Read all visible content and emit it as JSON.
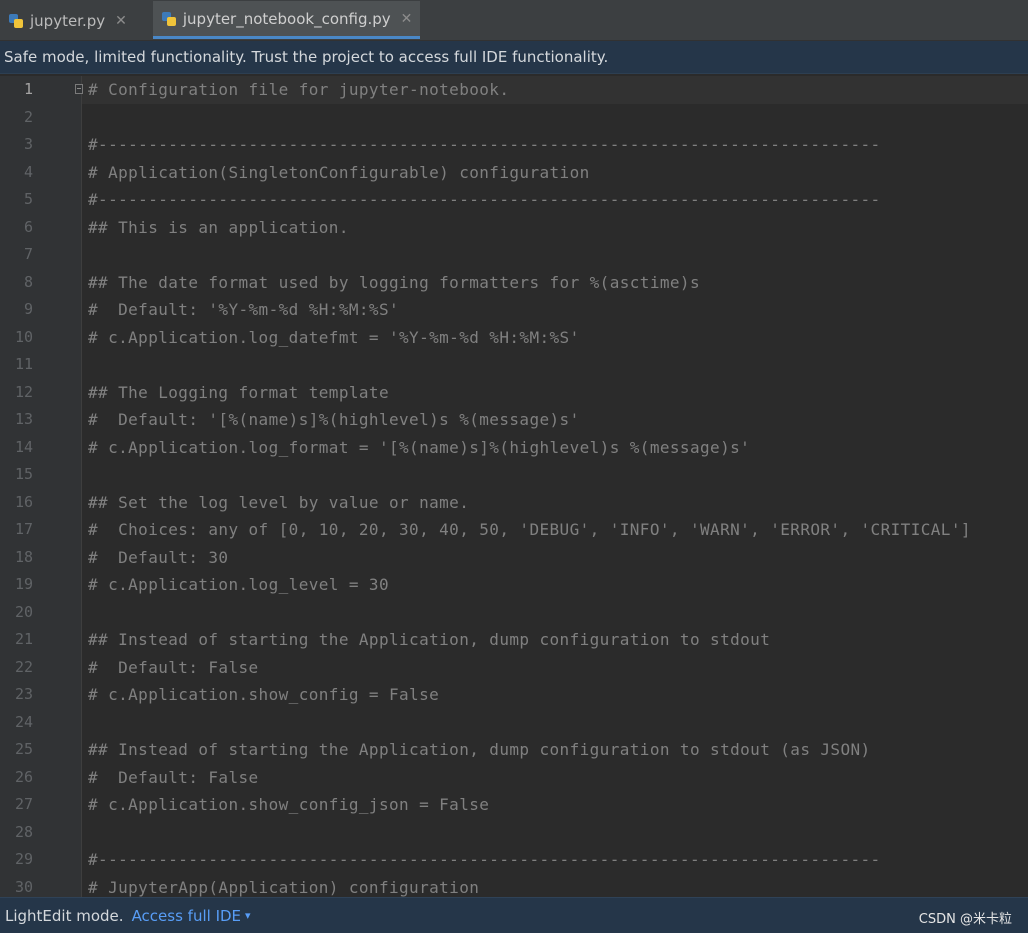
{
  "tabs": [
    {
      "label": "jupyter.py",
      "active": false
    },
    {
      "label": "jupyter_notebook_config.py",
      "active": true
    }
  ],
  "banner": {
    "text": "Safe mode, limited functionality. Trust the project to access full IDE functionality."
  },
  "editor": {
    "current_line": 1,
    "lines": [
      {
        "n": "1",
        "text": "# Configuration file for jupyter-notebook."
      },
      {
        "n": "2",
        "text": ""
      },
      {
        "n": "3",
        "text": "#------------------------------------------------------------------------------"
      },
      {
        "n": "4",
        "text": "# Application(SingletonConfigurable) configuration"
      },
      {
        "n": "5",
        "text": "#------------------------------------------------------------------------------"
      },
      {
        "n": "6",
        "text": "## This is an application."
      },
      {
        "n": "7",
        "text": ""
      },
      {
        "n": "8",
        "text": "## The date format used by logging formatters for %(asctime)s"
      },
      {
        "n": "9",
        "text": "#  Default: '%Y-%m-%d %H:%M:%S'"
      },
      {
        "n": "10",
        "text": "# c.Application.log_datefmt = '%Y-%m-%d %H:%M:%S'"
      },
      {
        "n": "11",
        "text": ""
      },
      {
        "n": "12",
        "text": "## The Logging format template"
      },
      {
        "n": "13",
        "text": "#  Default: '[%(name)s]%(highlevel)s %(message)s'"
      },
      {
        "n": "14",
        "text": "# c.Application.log_format = '[%(name)s]%(highlevel)s %(message)s'"
      },
      {
        "n": "15",
        "text": ""
      },
      {
        "n": "16",
        "text": "## Set the log level by value or name."
      },
      {
        "n": "17",
        "text": "#  Choices: any of [0, 10, 20, 30, 40, 50, 'DEBUG', 'INFO', 'WARN', 'ERROR', 'CRITICAL']"
      },
      {
        "n": "18",
        "text": "#  Default: 30"
      },
      {
        "n": "19",
        "text": "# c.Application.log_level = 30"
      },
      {
        "n": "20",
        "text": ""
      },
      {
        "n": "21",
        "text": "## Instead of starting the Application, dump configuration to stdout"
      },
      {
        "n": "22",
        "text": "#  Default: False"
      },
      {
        "n": "23",
        "text": "# c.Application.show_config = False"
      },
      {
        "n": "24",
        "text": ""
      },
      {
        "n": "25",
        "text": "## Instead of starting the Application, dump configuration to stdout (as JSON)"
      },
      {
        "n": "26",
        "text": "#  Default: False"
      },
      {
        "n": "27",
        "text": "# c.Application.show_config_json = False"
      },
      {
        "n": "28",
        "text": ""
      },
      {
        "n": "29",
        "text": "#------------------------------------------------------------------------------"
      },
      {
        "n": "30",
        "text": "# JupyterApp(Application) configuration"
      }
    ]
  },
  "statusbar": {
    "mode": "LightEdit mode.",
    "link": "Access full IDE",
    "watermark": "CSDN @米卡粒"
  },
  "icons": {
    "tab_file": "python-file-icon",
    "tab_close": "close-icon",
    "fold": "fold-marker-icon",
    "link_dropdown": "chevron-down-icon"
  },
  "colors": {
    "background": "#2b2b2b",
    "comment": "#808080",
    "banner": "#253649",
    "link": "#589df6"
  }
}
